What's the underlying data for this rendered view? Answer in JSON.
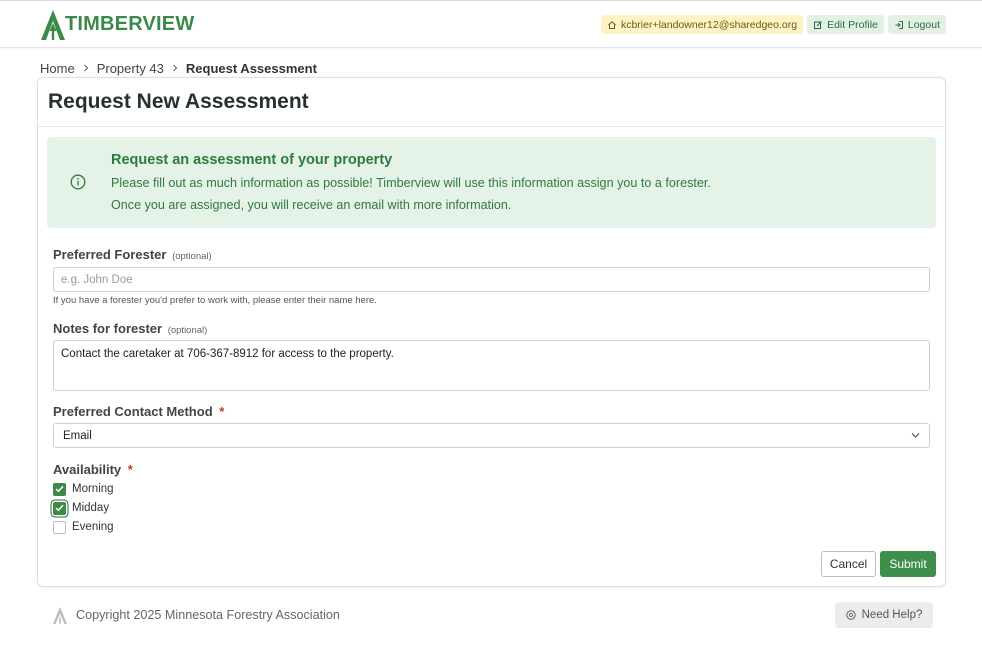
{
  "header": {
    "logo_text": "TIMBERVIEW",
    "user_email": "kcbrier+landowner12@sharedgeo.org",
    "edit_profile_label": "Edit Profile",
    "logout_label": "Logout"
  },
  "breadcrumb": {
    "items": [
      "Home",
      "Property 43",
      "Request Assessment"
    ]
  },
  "page": {
    "title": "Request New Assessment"
  },
  "notice": {
    "title": "Request an assessment of your property",
    "line1": "Please fill out as much information as possible! Timberview will use this information assign you to a forester.",
    "line2": "Once you are assigned, you will receive an email with more information."
  },
  "form": {
    "forester": {
      "label": "Preferred Forester",
      "optional_tag": "(optional)",
      "placeholder": "e.g. John Doe",
      "value": "",
      "help": "If you have a forester you'd prefer to work with, please enter their name here."
    },
    "notes": {
      "label": "Notes for forester",
      "optional_tag": "(optional)",
      "value": "Contact the caretaker at 706-367-8912 for access to the property."
    },
    "contact": {
      "label": "Preferred Contact Method",
      "required_mark": "*",
      "selected": "Email"
    },
    "availability": {
      "label": "Availability",
      "required_mark": "*",
      "options": [
        {
          "label": "Morning",
          "checked": true
        },
        {
          "label": "Midday",
          "checked": true
        },
        {
          "label": "Evening",
          "checked": false
        }
      ]
    },
    "cancel_label": "Cancel",
    "submit_label": "Submit"
  },
  "footer": {
    "copyright": "Copyright 2025 Minnesota Forestry Association",
    "help_label": "Need Help?"
  },
  "colors": {
    "brand_green": "#3c8a4a",
    "submit_green": "#3e8f4b",
    "notice_bg": "#e5f2e7",
    "user_pill_bg": "#fdf3c4",
    "required_red": "#c0392b"
  }
}
